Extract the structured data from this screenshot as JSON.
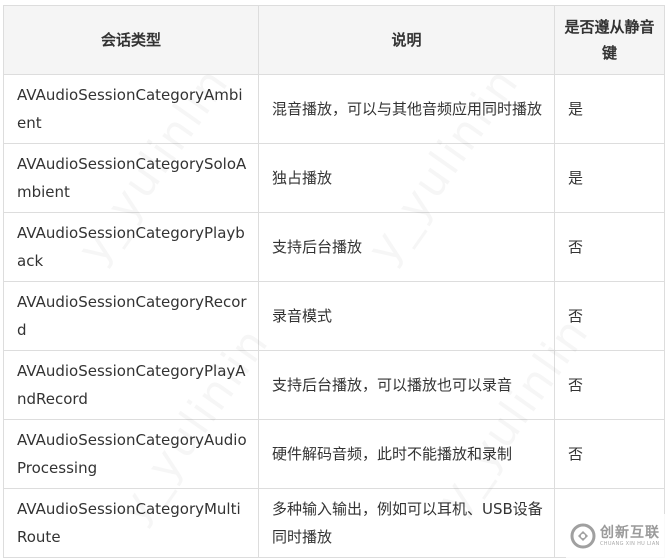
{
  "table": {
    "headers": [
      "会话类型",
      "说明",
      "是否遵从静音键"
    ],
    "rows": [
      {
        "category": "AVAudioSessionCategoryAmbient",
        "description": "混音播放，可以与其他音频应用同时播放",
        "follows_mute": "是"
      },
      {
        "category": "AVAudioSessionCategorySoloAmbient",
        "description": "独占播放",
        "follows_mute": "是"
      },
      {
        "category": "AVAudioSessionCategoryPlayback",
        "description": "支持后台播放",
        "follows_mute": "否"
      },
      {
        "category": "AVAudioSessionCategoryRecord",
        "description": "录音模式",
        "follows_mute": "否"
      },
      {
        "category": "AVAudioSessionCategoryPlayAndRecord",
        "description": "支持后台播放，可以播放也可以录音",
        "follows_mute": "否"
      },
      {
        "category": "AVAudioSessionCategoryAudioProcessing",
        "description": "硬件解码音频，此时不能播放和录制",
        "follows_mute": "否"
      },
      {
        "category": "AVAudioSessionCategoryMultiRoute",
        "description": "多种输入输出，例如可以耳机、USB设备同时播放",
        "follows_mute": ""
      }
    ]
  },
  "watermark": {
    "text": "y_yulinlin"
  },
  "logo": {
    "name_cn": "创新互联",
    "name_en": "CHUANG XIN HU LIAN",
    "color": "#9a9a9a"
  }
}
